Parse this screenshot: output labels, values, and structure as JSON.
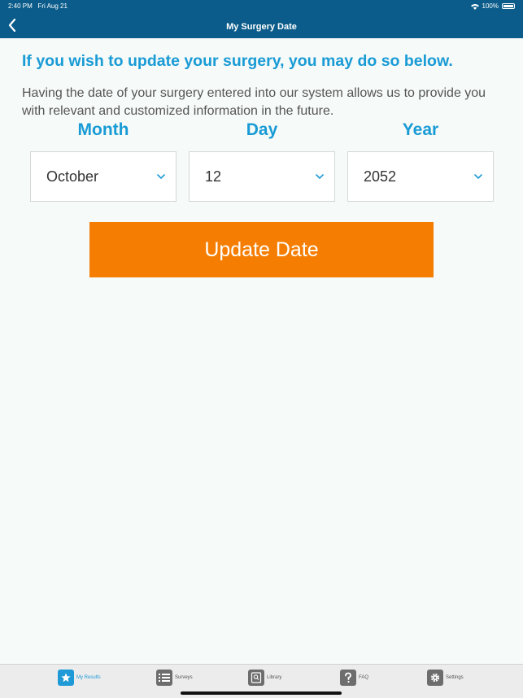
{
  "status_bar": {
    "time": "2:40 PM",
    "date": "Fri Aug 21",
    "battery": "100%"
  },
  "header": {
    "title": "My Surgery Date"
  },
  "content": {
    "headline": "If you wish to update your surgery, you may do so below.",
    "description": "Having the date of your surgery entered into our system allows us to provide you with relevant and customized information in the future.",
    "labels": {
      "month": "Month",
      "day": "Day",
      "year": "Year"
    },
    "selects": {
      "month": "October",
      "day": "12",
      "year": "2052"
    },
    "update_button": "Update Date"
  },
  "tabs": [
    {
      "label": "My Results",
      "icon": "star-icon",
      "active": true
    },
    {
      "label": "Surveys",
      "icon": "list-icon",
      "active": false
    },
    {
      "label": "Library",
      "icon": "book-search-icon",
      "active": false
    },
    {
      "label": "FAQ",
      "icon": "question-icon",
      "active": false
    },
    {
      "label": "Settings",
      "icon": "gear-icon",
      "active": false
    }
  ],
  "colors": {
    "header": "#0b5c8a",
    "accent": "#199bd6",
    "button": "#f57e02",
    "background": "#f6faf8"
  }
}
